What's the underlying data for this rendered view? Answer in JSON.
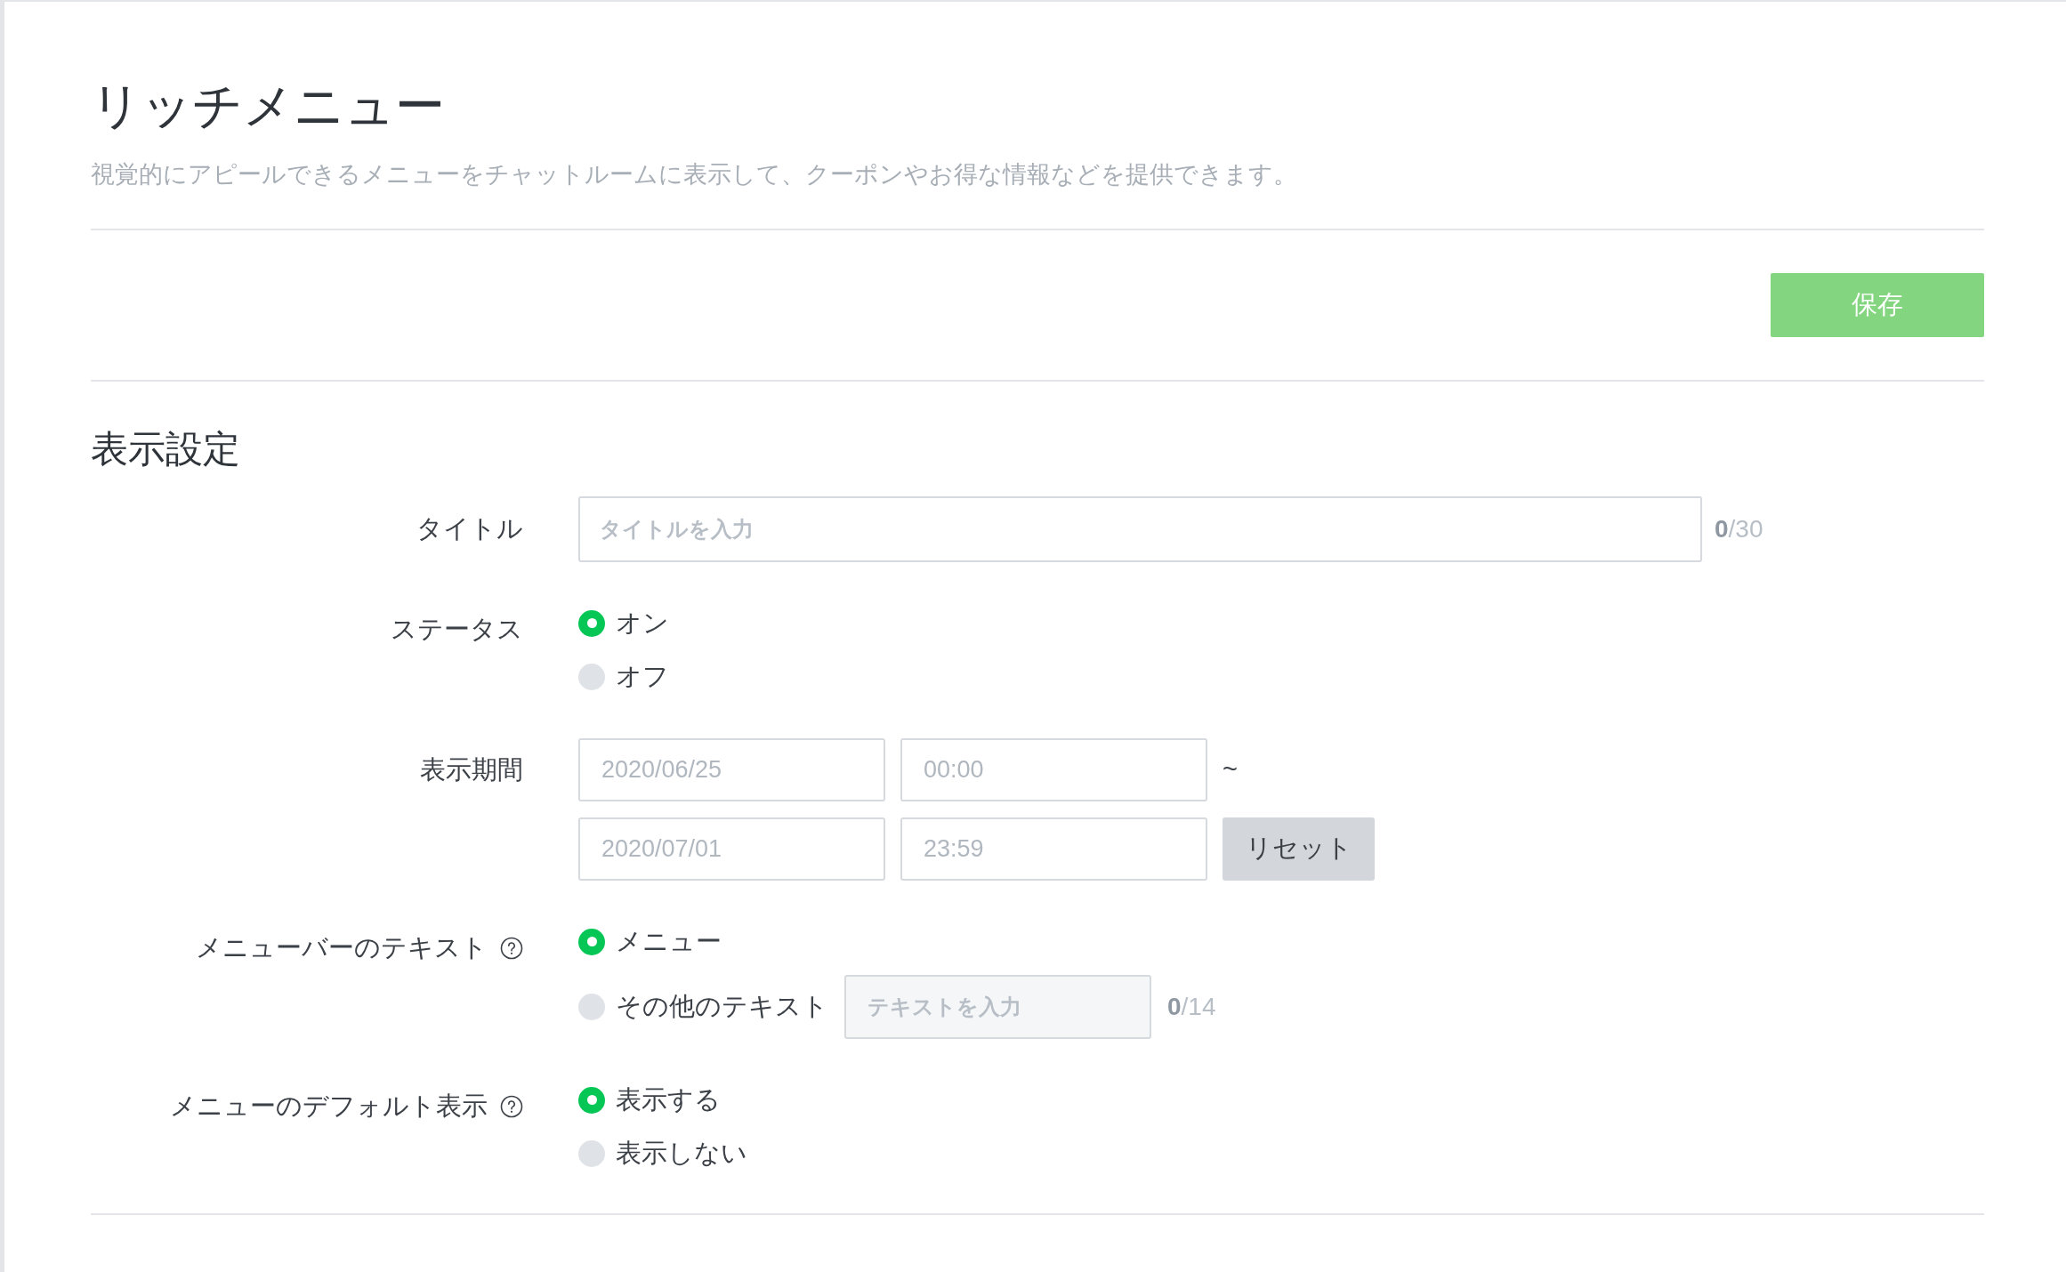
{
  "page": {
    "title": "リッチメニュー",
    "description": "視覚的にアピールできるメニューをチャットルームに表示して、クーポンやお得な情報などを提供できます。"
  },
  "save_button": "保存",
  "section": {
    "title": "表示設定",
    "fields": [
      {
        "kind": "text",
        "label": "タイトル",
        "placeholder": "タイトルを入力",
        "counter": "**0**/30"
      },
      {
        "kind": "radio",
        "label": "ステータス",
        "help": false,
        "options": [
          {
            "label": "オン",
            "selected": true
          },
          {
            "label": "オフ",
            "selected": false
          }
        ]
      },
      {
        "kind": "period",
        "label": "表示期間",
        "rows": [
          {
            "date": "2020/06/25",
            "time": "00:00"
          },
          {
            "date": "2020/07/01",
            "time": "23:59"
          }
        ],
        "separator": "~",
        "reset": "リセット"
      },
      {
        "kind": "radio",
        "label": "メニューバーのテキスト",
        "help": true,
        "options": [
          {
            "label": "メニュー",
            "selected": true
          },
          {
            "label": "その他のテキスト",
            "selected": false,
            "input": {
              "placeholder": "テキストを入力",
              "counter": "**0**/14"
            }
          }
        ]
      },
      {
        "kind": "radio",
        "label": "メニューのデフォルト表示",
        "help": true,
        "options": [
          {
            "label": "表示する",
            "selected": true
          },
          {
            "label": "表示しない",
            "selected": false
          }
        ]
      }
    ]
  }
}
